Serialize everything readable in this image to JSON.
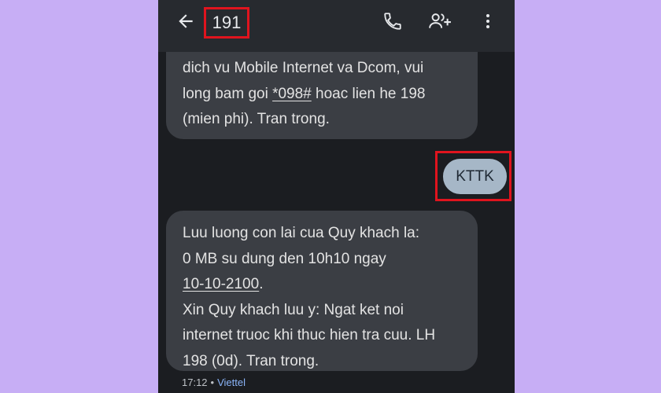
{
  "header": {
    "title": "191",
    "icons": [
      "back-arrow-icon",
      "phone-icon",
      "add-person-icon",
      "more-vert-icon"
    ]
  },
  "messages": {
    "incoming_1": {
      "lines": [
        "dich vu Mobile Internet va Dcom, vui",
        "long bam goi ",
        "*098#",
        " hoac lien he 198",
        "(mien phi). Tran trong."
      ]
    },
    "outgoing": {
      "text": "KTTK"
    },
    "incoming_2": {
      "lines": [
        "Luu luong con lai cua Quy khach la:",
        "0 MB su dung den 10h10 ngay",
        "10-10-2100",
        ".",
        "Xin Quy khach luu y: Ngat ket noi",
        "internet truoc khi thuc hien tra cuu. LH",
        "198 (0d). Tran trong."
      ]
    },
    "meta": {
      "time": "17:12",
      "separator": "•",
      "carrier": "Viettel"
    }
  },
  "colors": {
    "page_bg": "#c7aef5",
    "screen_bg": "#1b1d21",
    "topbar_bg": "#272a2f",
    "incoming_bubble": "#3b3e44",
    "outgoing_bubble": "#a6b7c7",
    "highlight_border": "#e0141e",
    "carrier_link": "#8ab4f8"
  }
}
